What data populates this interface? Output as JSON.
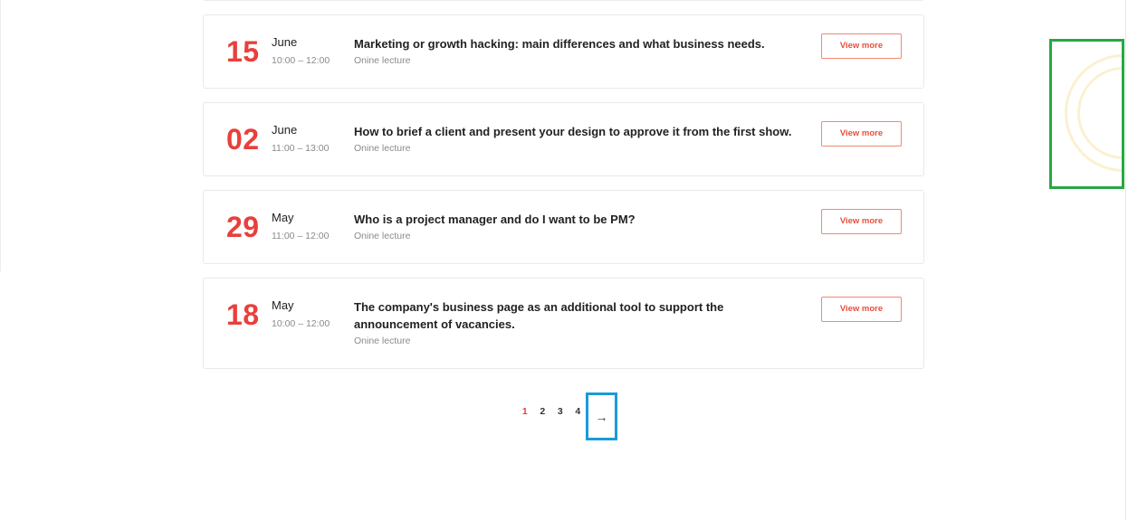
{
  "events": [
    {
      "day": "15",
      "month": "June",
      "time": "10:00 – 12:00",
      "title": "Marketing or growth hacking: main differences and what business needs.",
      "kind": "Onine lecture",
      "button_label": "View more"
    },
    {
      "day": "02",
      "month": "June",
      "time": "11:00 – 13:00",
      "title": "How to brief a client and present your design to approve it from the first show.",
      "kind": "Onine lecture",
      "button_label": "View more"
    },
    {
      "day": "29",
      "month": "May",
      "time": "11:00 – 12:00",
      "title": "Who is a project manager and do I want to be PM?",
      "kind": "Onine lecture",
      "button_label": "View more"
    },
    {
      "day": "18",
      "month": "May",
      "time": "10:00 – 12:00",
      "title": "The company's business page as an additional tool to support the announcement of vacancies.",
      "kind": "Onine lecture",
      "button_label": "View more"
    }
  ],
  "pagination": {
    "pages": [
      "1",
      "2",
      "3",
      "4"
    ],
    "active": "1",
    "next_icon": "→"
  },
  "colors": {
    "accent": "#e8403c",
    "button_border": "#f08a72",
    "muted_text": "#8a8a8a",
    "highlight_blue": "#1a9bd8",
    "highlight_green": "#27a844"
  }
}
